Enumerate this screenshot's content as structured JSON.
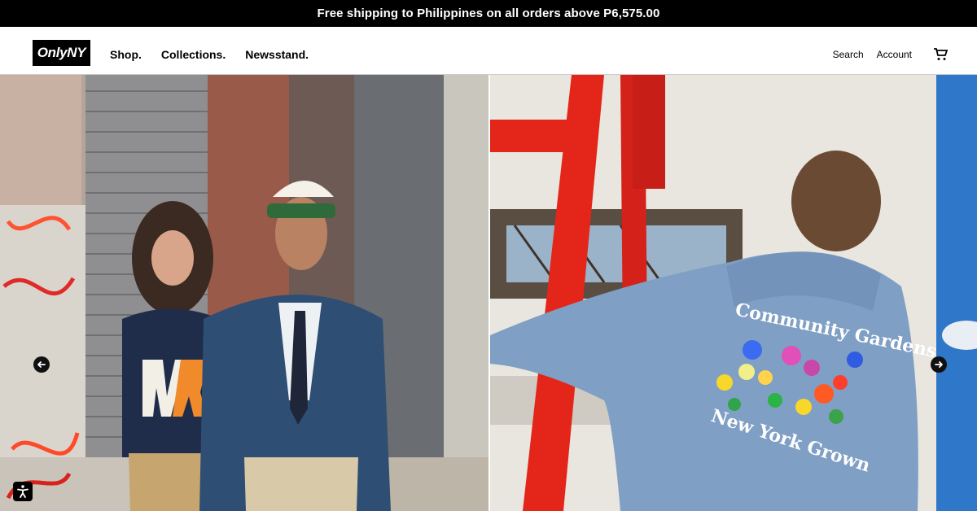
{
  "announcement": {
    "text": "Free shipping to Philippines on all orders above P6,575.00"
  },
  "header": {
    "logo": "OnlyNY",
    "nav": [
      {
        "label": "Shop."
      },
      {
        "label": "Collections."
      },
      {
        "label": "Newsstand."
      }
    ],
    "search_label": "Search",
    "account_label": "Account",
    "cart_icon": "cart-icon"
  },
  "hero": {
    "slides": [
      {
        "description": "Couple walking on NYC street; sweater graphic NY",
        "graphic_text": "NY"
      },
      {
        "description": "Man in blue jacket with embroidered flowers",
        "jacket_text_top": "Community Gardens",
        "jacket_text_bottom": "New York Grown"
      }
    ],
    "prev_icon": "arrow-left-icon",
    "next_icon": "arrow-right-icon"
  },
  "accessibility": {
    "icon": "accessibility-icon"
  },
  "colors": {
    "announcement_bg": "#000000",
    "brand_black": "#000000",
    "jacket_blue": "#7f9fc4",
    "ladder_red": "#e32619"
  }
}
